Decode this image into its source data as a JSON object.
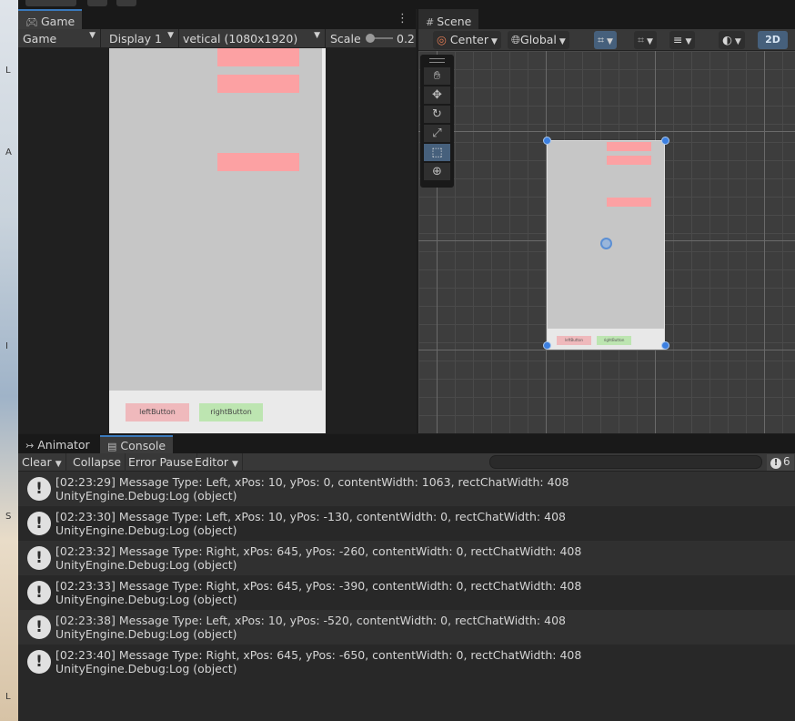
{
  "game_panel": {
    "tab_title": "Game",
    "tab_icon": "gamepad-icon",
    "mode": "Game",
    "display": "Display 1",
    "resolution": "vetical (1080x1920)",
    "scale_label": "Scale",
    "scale_value": "0.2",
    "buttons": {
      "left": "leftButton",
      "right": "rightButton"
    }
  },
  "scene_panel": {
    "tab_title": "Scene",
    "tab_icon": "hash-icon",
    "pivot_mode": "Center",
    "pivot_rotation": "Global",
    "mode_2d": "2D",
    "tools": [
      "hand-icon",
      "move-icon",
      "rotate-icon",
      "scale-icon",
      "rect-icon",
      "transform-icon"
    ],
    "active_tool": "rect-icon",
    "mini_buttons": {
      "left": "leftButton",
      "right": "rightButton"
    }
  },
  "bottom_panel": {
    "tabs": [
      {
        "label": "Animator",
        "icon": "animator-icon"
      },
      {
        "label": "Console",
        "icon": "console-icon"
      }
    ],
    "toolbar": {
      "clear": "Clear",
      "collapse": "Collapse",
      "error_pause": "Error Pause",
      "editor": "Editor",
      "search_placeholder": ""
    },
    "log_count": "6",
    "logs": [
      {
        "line1": "[02:23:29] Message Type: Left, xPos: 10, yPos: 0, contentWidth: 1063, rectChatWidth: 408",
        "line2": "UnityEngine.Debug:Log (object)"
      },
      {
        "line1": "[02:23:30] Message Type: Left, xPos: 10, yPos: -130, contentWidth: 0, rectChatWidth: 408",
        "line2": "UnityEngine.Debug:Log (object)"
      },
      {
        "line1": "[02:23:32] Message Type: Right, xPos: 645, yPos: -260, contentWidth: 0, rectChatWidth: 408",
        "line2": "UnityEngine.Debug:Log (object)"
      },
      {
        "line1": "[02:23:33] Message Type: Right, xPos: 645, yPos: -390, contentWidth: 0, rectChatWidth: 408",
        "line2": "UnityEngine.Debug:Log (object)"
      },
      {
        "line1": "[02:23:38] Message Type: Left, xPos: 10, yPos: -520, contentWidth: 0, rectChatWidth: 408",
        "line2": "UnityEngine.Debug:Log (object)"
      },
      {
        "line1": "[02:23:40] Message Type: Right, xPos: 645, yPos: -650, contentWidth: 0, rectChatWidth: 408",
        "line2": "UnityEngine.Debug:Log (object)"
      }
    ]
  },
  "colors": {
    "accent": "#3a79bb",
    "chat_bubble": "#fca1a3",
    "left_button": "#efb9bc",
    "right_button": "#bde5b1"
  }
}
